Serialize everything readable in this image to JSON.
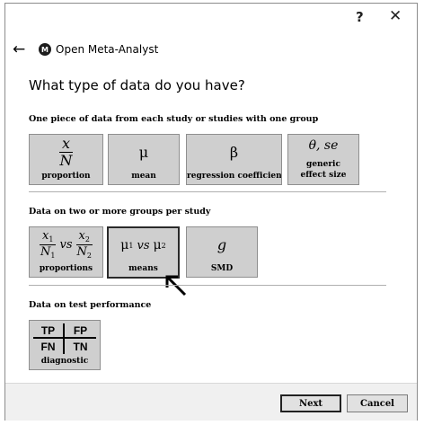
{
  "window": {
    "help_label": "?",
    "close_label": "✕",
    "back_label": "←"
  },
  "app": {
    "title": "Open Meta-Analyst",
    "logo_letter": "M"
  },
  "question": "What type of data do you have?",
  "sections": [
    {
      "label": "One piece of data from each study or studies with one group",
      "tiles": [
        {
          "label": "proportion",
          "num": "x",
          "den": "N"
        },
        {
          "label": "mean",
          "symbol": "μ"
        },
        {
          "label": "regression coefficient",
          "symbol": "β"
        },
        {
          "label": "generic effect size",
          "label_line1": "generic",
          "label_line2": "effect size",
          "symbol": "θ, se"
        }
      ]
    },
    {
      "label": "Data on two or more groups per study",
      "tiles": [
        {
          "label": "proportions",
          "n1": "x",
          "d1": "N",
          "vs": "vs",
          "n2": "x",
          "d2": "N",
          "sub1": "1",
          "sub2": "2"
        },
        {
          "label": "means",
          "m1": "μ",
          "vs": "vs",
          "m2": "μ",
          "sub1": "1",
          "sub2": "2",
          "selected": true
        },
        {
          "label": "SMD",
          "symbol": "g"
        }
      ]
    },
    {
      "label": "Data on test performance",
      "tiles": [
        {
          "label": "diagnostic",
          "cells": [
            "TP",
            "FP",
            "FN",
            "TN"
          ]
        }
      ]
    }
  ],
  "buttons": {
    "next": "Next",
    "cancel": "Cancel"
  }
}
